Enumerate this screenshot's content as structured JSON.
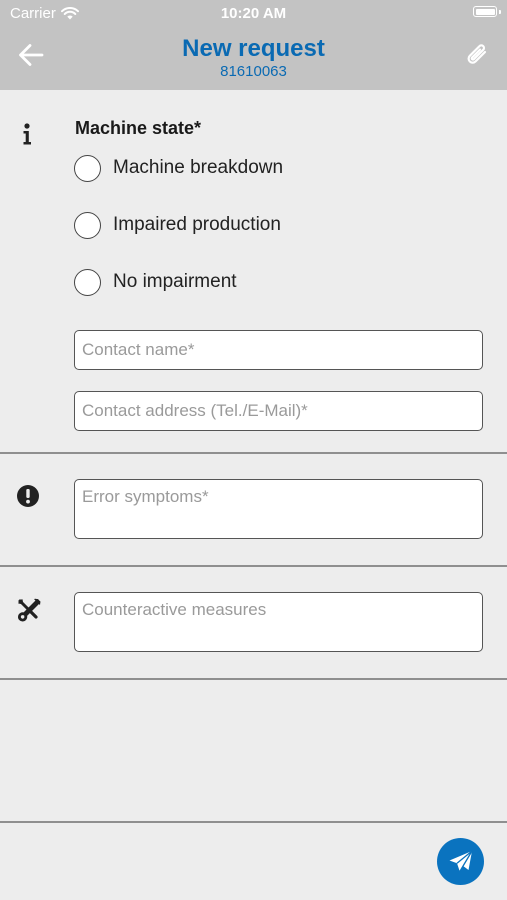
{
  "status_bar": {
    "carrier": "Carrier",
    "time": "10:20 AM"
  },
  "header": {
    "title": "New request",
    "subtitle": "81610063"
  },
  "machine_state": {
    "label": "Machine state*",
    "options": [
      {
        "label": "Machine breakdown",
        "selected": false
      },
      {
        "label": "Impaired production",
        "selected": false
      },
      {
        "label": "No impairment",
        "selected": false
      }
    ]
  },
  "fields": {
    "contact_name": {
      "placeholder": "Contact name*",
      "value": ""
    },
    "contact_address": {
      "placeholder": "Contact address (Tel./E-Mail)*",
      "value": ""
    },
    "error_symptoms": {
      "placeholder": "Error symptoms*",
      "value": ""
    },
    "counteractive_measures": {
      "placeholder": "Counteractive measures",
      "value": ""
    }
  },
  "icons": {
    "info": "info-icon",
    "error": "exclamation-circle-icon",
    "tools": "tools-icon",
    "back": "arrow-left-icon",
    "attach": "paperclip-icon",
    "send": "paper-plane-icon"
  },
  "colors": {
    "accent": "#0a6ab3",
    "header_bg": "#c3c3c3",
    "page_bg": "#ededed",
    "send_button": "#0a73bf"
  }
}
